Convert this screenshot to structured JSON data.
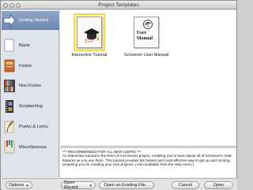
{
  "window": {
    "title": "Project Templates"
  },
  "sidebar": {
    "items": [
      {
        "label": "Getting Started",
        "selected": true,
        "icon": "arrow-right-icon"
      },
      {
        "label": "Blank",
        "icon": "blank-page-icon"
      },
      {
        "label": "Fiction",
        "icon": "fiction-book-icon"
      },
      {
        "label": "Non-Fiction",
        "icon": "bookshelf-icon"
      },
      {
        "label": "Scriptwriting",
        "icon": "film-strip-icon"
      },
      {
        "label": "Poetry & Lyrics",
        "icon": "quill-icon"
      },
      {
        "label": "Miscellaneous",
        "icon": "bookmarks-icon"
      }
    ]
  },
  "templates": [
    {
      "label": "Interactive Tutorial",
      "selected": true,
      "icon": "graduation-cap-icon"
    },
    {
      "label": "Scrivener User Manual",
      "selected": false,
      "icon": "user-manual-icon",
      "cover_text": [
        "User",
        "Manual"
      ]
    }
  ],
  "description": {
    "heading": "*** RECOMMENDED FOR ALL NEW USERS ***",
    "body": "An interactive tutorial in the form of a Scrivener project, enabling you to learn about all of Scrivener's main features as you use them. This tutorial provides the fastest and most effective way to get up and running, preparing you for creating your own projects. (Also available from the Help menu.)"
  },
  "buttons": {
    "options": "Options",
    "open_recent": "Open Recent",
    "open_existing": "Open an Existing File...",
    "cancel": "Cancel",
    "open": "Open"
  },
  "colors": {
    "selection": "#7b93bb",
    "template_highlight": "#f1d84d",
    "sidebar_bg": "#dfe4ec"
  }
}
